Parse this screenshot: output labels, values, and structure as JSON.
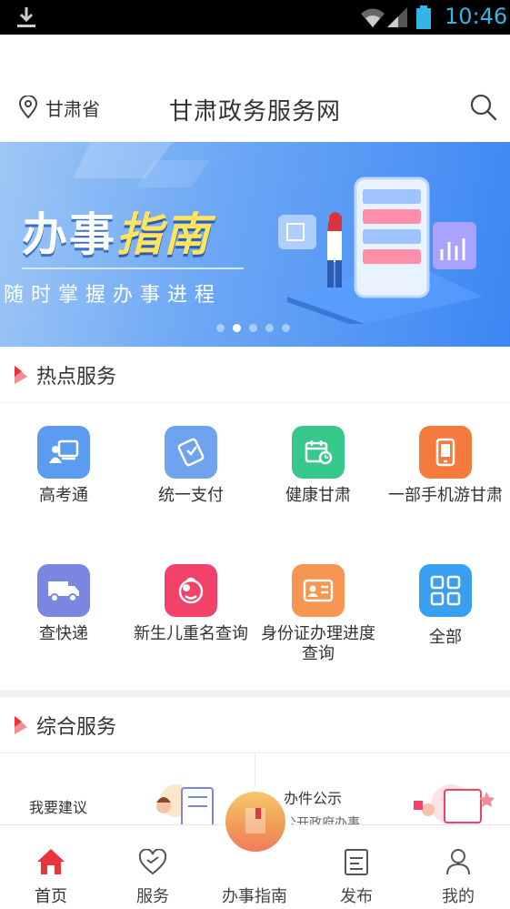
{
  "status_bar": {
    "time": "10:46"
  },
  "header": {
    "location": "甘肃省",
    "title": "甘肃政务服务网"
  },
  "banner": {
    "title_part1": "办事",
    "title_part2": "指南",
    "subtitle": "随时掌握办事进程",
    "active_dot": 1,
    "dot_count": 5
  },
  "hot_services": {
    "title": "热点服务",
    "items": [
      {
        "label": "高考通",
        "icon": "exam-board-icon",
        "color": "#5b9bf0"
      },
      {
        "label": "统一支付",
        "icon": "payment-card-icon",
        "color": "#6fa3ef"
      },
      {
        "label": "健康甘肃",
        "icon": "health-calendar-icon",
        "color": "#36c98b"
      },
      {
        "label": "一部手机游甘肃",
        "icon": "mobile-phone-icon",
        "color": "#f47a3e"
      },
      {
        "label": "查快递",
        "icon": "delivery-truck-icon",
        "color": "#7a86e0"
      },
      {
        "label": "新生儿重名查询",
        "icon": "baby-face-icon",
        "color": "#f2426a"
      },
      {
        "label": "身份证办理进度查询",
        "icon": "id-card-icon",
        "color": "#f79552"
      },
      {
        "label": "全部",
        "icon": "grid-icon",
        "color": "#3b9ff1"
      }
    ]
  },
  "comprehensive": {
    "title": "综合服务",
    "left_label": "我要建议",
    "right_label": "办件公示",
    "right_sub": "公开政府办事"
  },
  "bottom_nav": {
    "items": [
      {
        "label": "首页",
        "icon": "home-icon",
        "active": true
      },
      {
        "label": "服务",
        "icon": "heart-icon",
        "active": false
      },
      {
        "label": "办事指南",
        "icon": "guide-book-icon",
        "active": false
      },
      {
        "label": "发布",
        "icon": "edit-document-icon",
        "active": false
      },
      {
        "label": "我的",
        "icon": "user-icon",
        "active": false
      }
    ]
  },
  "colors": {
    "accent_red": "#e8343a",
    "banner_blue": "#3c86f3",
    "status_text": "#33b5e5"
  }
}
